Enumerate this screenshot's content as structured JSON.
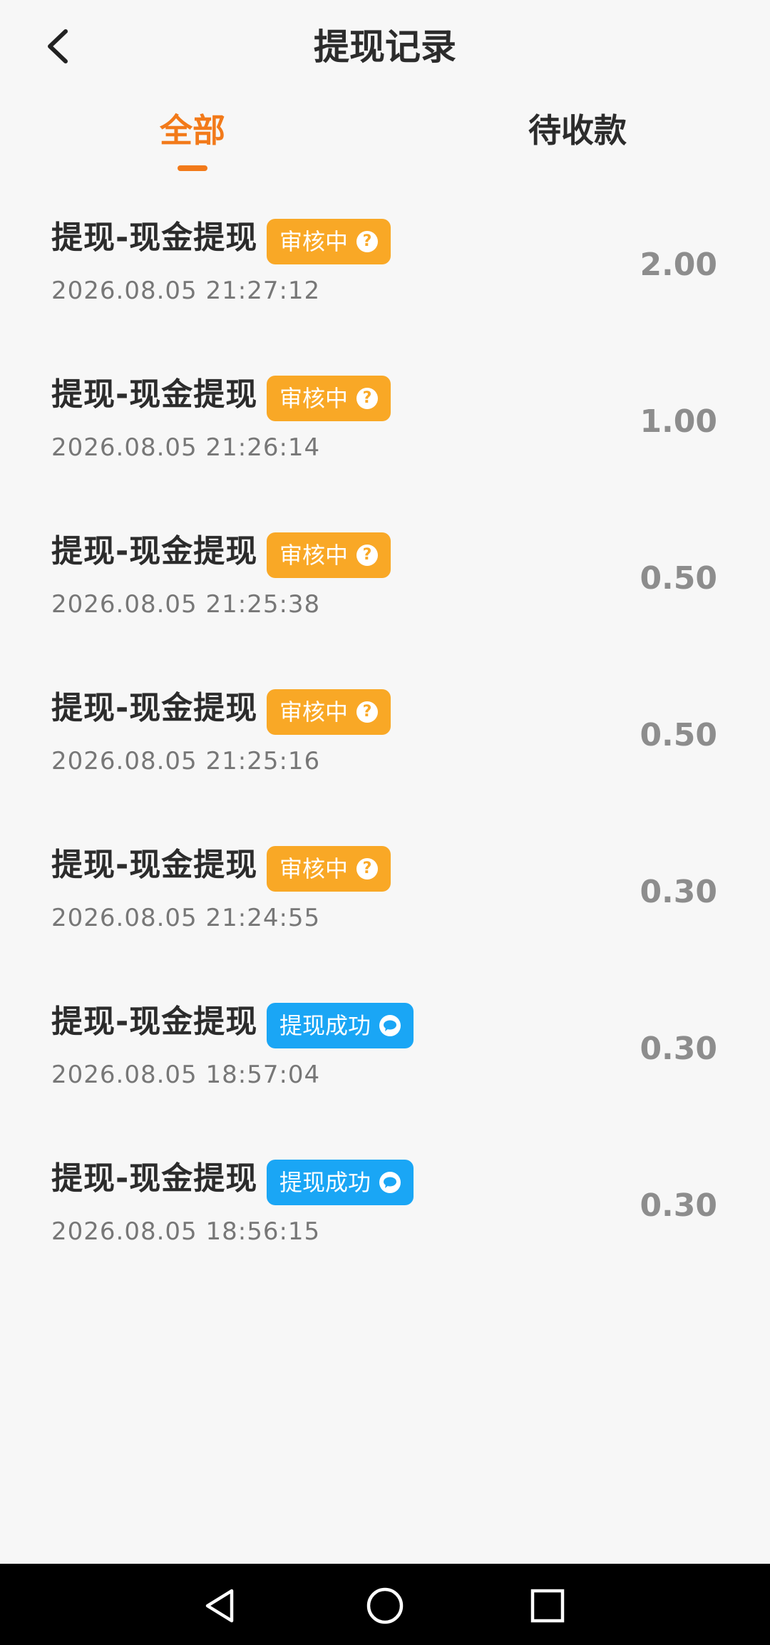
{
  "header": {
    "title": "提现记录"
  },
  "tabs": [
    {
      "label": "全部",
      "active": true
    },
    {
      "label": "待收款",
      "active": false
    }
  ],
  "records": [
    {
      "title": "提现-现金提现",
      "status": "审核中",
      "status_type": "pending",
      "status_icon": "question-icon",
      "time": "2026.08.05 21:27:12",
      "amount": "2.00"
    },
    {
      "title": "提现-现金提现",
      "status": "审核中",
      "status_type": "pending",
      "status_icon": "question-icon",
      "time": "2026.08.05 21:26:14",
      "amount": "1.00"
    },
    {
      "title": "提现-现金提现",
      "status": "审核中",
      "status_type": "pending",
      "status_icon": "question-icon",
      "time": "2026.08.05 21:25:38",
      "amount": "0.50"
    },
    {
      "title": "提现-现金提现",
      "status": "审核中",
      "status_type": "pending",
      "status_icon": "question-icon",
      "time": "2026.08.05 21:25:16",
      "amount": "0.50"
    },
    {
      "title": "提现-现金提现",
      "status": "审核中",
      "status_type": "pending",
      "status_icon": "question-icon",
      "time": "2026.08.05 21:24:55",
      "amount": "0.30"
    },
    {
      "title": "提现-现金提现",
      "status": "提现成功",
      "status_type": "success",
      "status_icon": "wechat-icon",
      "time": "2026.08.05 18:57:04",
      "amount": "0.30"
    },
    {
      "title": "提现-现金提现",
      "status": "提现成功",
      "status_type": "success",
      "status_icon": "wechat-icon",
      "time": "2026.08.05 18:56:15",
      "amount": "0.30"
    }
  ],
  "colors": {
    "accent": "#f27a1a",
    "pending": "#f9a826",
    "success": "#1aa6f5"
  },
  "nav": {
    "back_icon": "triangle-back-icon",
    "home_icon": "circle-home-icon",
    "recents_icon": "square-recents-icon"
  }
}
